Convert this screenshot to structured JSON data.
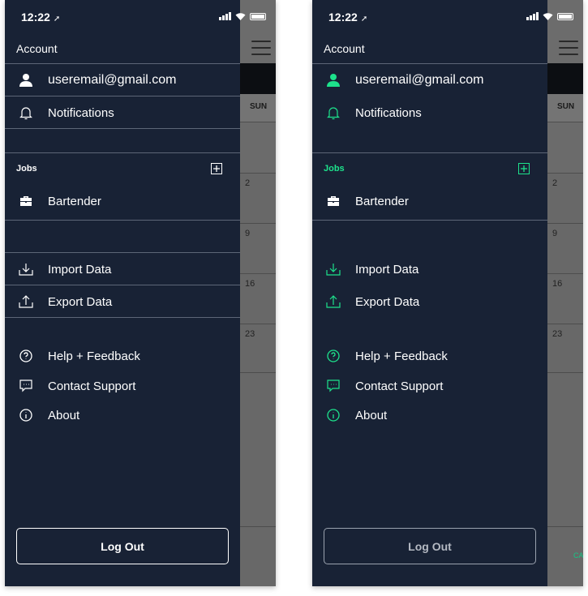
{
  "status_bar": {
    "time": "12:22"
  },
  "menu": {
    "account_title": "Account",
    "email": "useremail@gmail.com",
    "notifications": "Notifications",
    "jobs_label": "Jobs",
    "jobs": [
      {
        "label": "Bartender"
      }
    ],
    "import": "Import Data",
    "export": "Export Data",
    "help": "Help + Feedback",
    "contact": "Contact Support",
    "about": "About",
    "logout": "Log Out"
  },
  "background_calendar": {
    "day_header": "SUN",
    "dates": [
      "2",
      "9",
      "16",
      "23"
    ],
    "footer_fragment": "CA"
  },
  "colors": {
    "drawer_bg": "#182235",
    "accent": "#1de28c",
    "overlay": "#686868"
  },
  "icons": [
    "user-icon",
    "bell-icon",
    "plus-box-icon",
    "briefcase-icon",
    "import-icon",
    "export-icon",
    "help-icon",
    "chat-icon",
    "info-icon"
  ]
}
